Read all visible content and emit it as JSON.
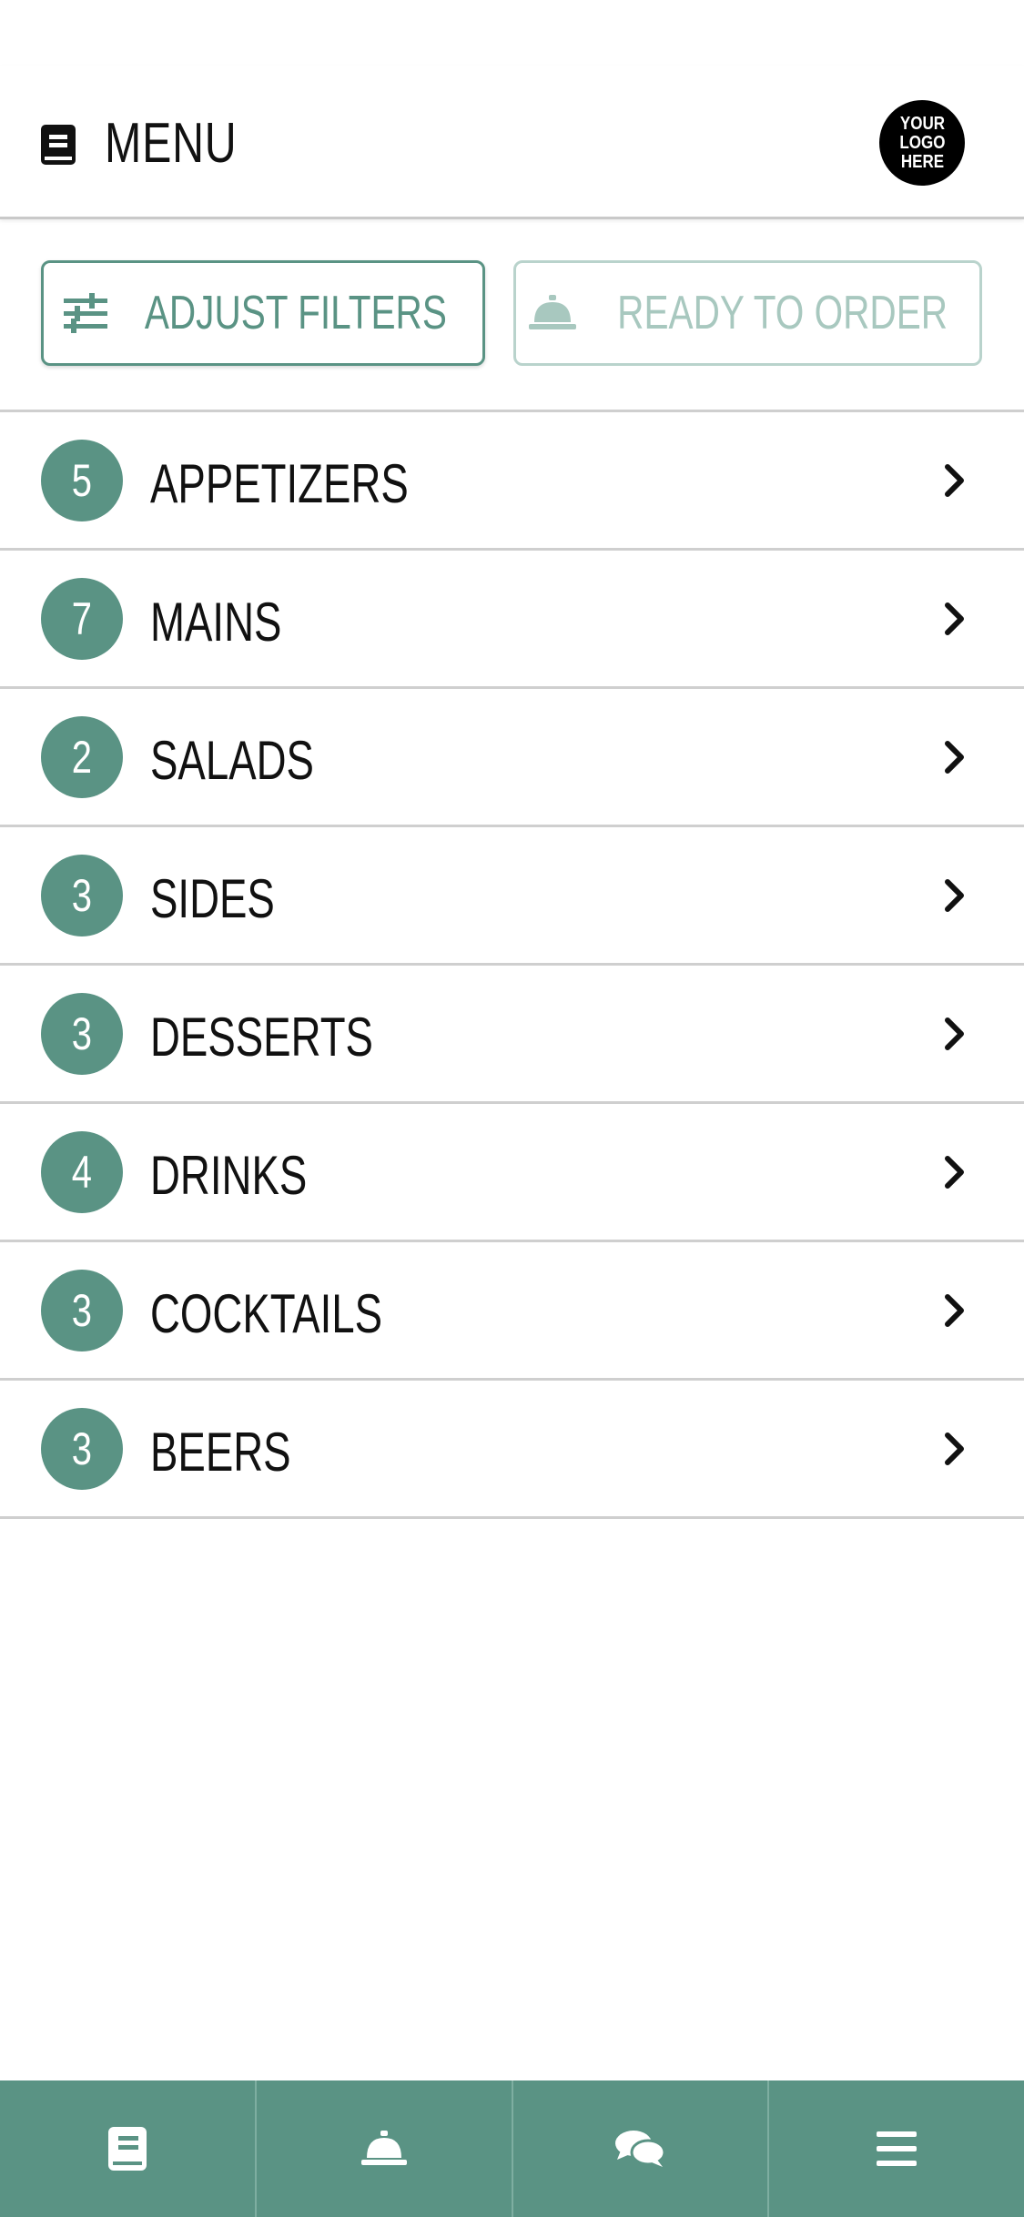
{
  "header": {
    "title": "MENU",
    "logo_text": "YOUR\nLOGO\nHERE"
  },
  "actions": {
    "filter_label": "ADJUST FILTERS",
    "order_label": "READY TO ORDER"
  },
  "categories": [
    {
      "count": "5",
      "label": "APPETIZERS"
    },
    {
      "count": "7",
      "label": "MAINS"
    },
    {
      "count": "2",
      "label": "SALADS"
    },
    {
      "count": "3",
      "label": "SIDES"
    },
    {
      "count": "3",
      "label": "DESSERTS"
    },
    {
      "count": "4",
      "label": "DRINKS"
    },
    {
      "count": "3",
      "label": "COCKTAILS"
    },
    {
      "count": "3",
      "label": "BEERS"
    }
  ],
  "bottom_nav": [
    {
      "icon": "menu-book-icon"
    },
    {
      "icon": "service-bell-icon"
    },
    {
      "icon": "chat-bubbles-icon"
    },
    {
      "icon": "hamburger-icon"
    }
  ],
  "colors": {
    "accent": "#5a9384",
    "accent_light": "#b9d3cc",
    "text": "#111111"
  }
}
